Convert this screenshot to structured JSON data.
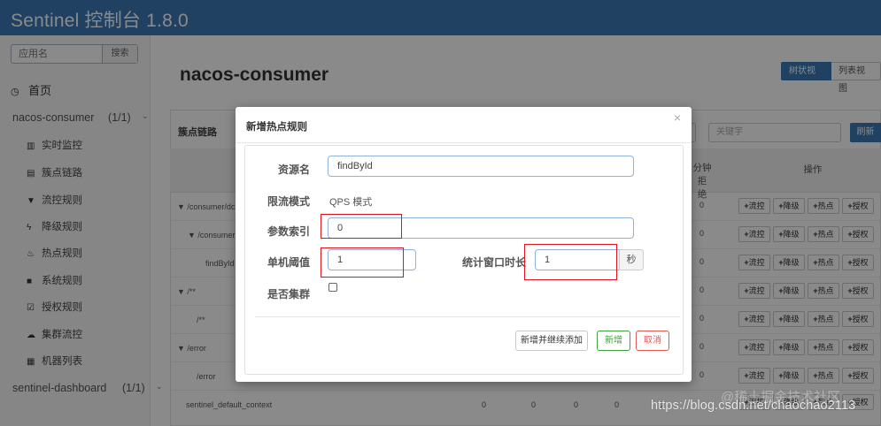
{
  "app": {
    "title": "Sentinel 控制台 1.8.0"
  },
  "sidebar": {
    "search_placeholder": "应用名",
    "search_button": "搜索",
    "home": "首页",
    "apps": [
      {
        "name": "nacos-consumer",
        "count": "(1/1)"
      },
      {
        "name": "sentinel-dashboard",
        "count": "(1/1)"
      }
    ],
    "menu": [
      {
        "label": "实时监控",
        "icon": "bar-chart-icon"
      },
      {
        "label": "簇点链路",
        "icon": "list-icon"
      },
      {
        "label": "流控规则",
        "icon": "filter-icon"
      },
      {
        "label": "降级规则",
        "icon": "flash-icon"
      },
      {
        "label": "热点规则",
        "icon": "fire-icon"
      },
      {
        "label": "系统规则",
        "icon": "lock-icon"
      },
      {
        "label": "授权规则",
        "icon": "check-icon"
      },
      {
        "label": "集群流控",
        "icon": "cloud-icon"
      },
      {
        "label": "机器列表",
        "icon": "th-list-icon"
      }
    ]
  },
  "main": {
    "title": "nacos-consumer",
    "view_tree": "树状视图",
    "view_list": "列表视图",
    "panel_label": "簇点链路",
    "keyword_placeholder": "关键字",
    "refresh": "刷新",
    "columns": {
      "blocked_qps": "分钟拒",
      "blocked_qps2": "绝",
      "ops": "操作"
    },
    "ops": {
      "flow": "流控",
      "degrade": "降级",
      "hot": "热点",
      "auth": "授权"
    },
    "rows": [
      {
        "name": "▼ /consumer/dc",
        "value": "0"
      },
      {
        "name": "▼ /consumer",
        "value": "0"
      },
      {
        "name": "findById",
        "value": "0"
      },
      {
        "name": "▼ /**",
        "value": "0"
      },
      {
        "name": "/**",
        "value": "0"
      },
      {
        "name": "▼ /error",
        "value": "0"
      },
      {
        "name": "/error",
        "value": "0"
      }
    ],
    "last_row": {
      "name": "sentinel_default_context",
      "values": [
        "0",
        "0",
        "0",
        "0",
        "0"
      ]
    }
  },
  "modal": {
    "title": "新增热点规则",
    "close": "×",
    "resource_label": "资源名",
    "resource_value": "findById",
    "mode_label": "限流模式",
    "mode_value": "QPS 模式",
    "param_label": "参数索引",
    "param_value": "0",
    "threshold_label": "单机阈值",
    "threshold_value": "1",
    "window_label": "统计窗口时长",
    "window_value": "1",
    "window_unit": "秒",
    "cluster_label": "是否集群",
    "btn_add_continue": "新增并继续添加",
    "btn_add": "新增",
    "btn_cancel": "取消"
  },
  "watermark": "https://blog.csdn.net/chaochao2113",
  "watermark_ghost": "@稀土掘金技术社区",
  "colors": {
    "topbar": "#3c78b4",
    "highlight": "#e0141e",
    "success": "#3fa03f",
    "danger": "#e05a5a"
  }
}
